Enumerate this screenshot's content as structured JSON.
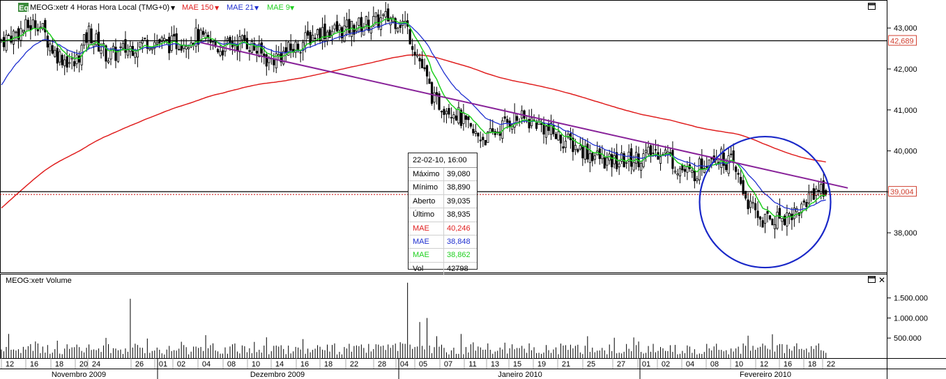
{
  "header": {
    "badge": "Eq",
    "symbol_line": "MEOG:xetr 4 Horas Hora Local (TMG+0)",
    "legend": [
      {
        "label": "MAE 150",
        "color": "#e02020"
      },
      {
        "label": "MAE 21",
        "color": "#2030d0"
      },
      {
        "label": "MAE 9",
        "color": "#20d020"
      }
    ]
  },
  "volume_panel": {
    "title": "MEOG:xetr Volume"
  },
  "tooltip": {
    "date": "22-02-10, 16:00",
    "rows": [
      {
        "label": "Máximo",
        "value": "39,080",
        "color": "#000000"
      },
      {
        "label": "Mínimo",
        "value": "38,890",
        "color": "#000000"
      },
      {
        "label": "Aberto",
        "value": "39,035",
        "color": "#000000"
      },
      {
        "label": "Último",
        "value": "38,935",
        "color": "#000000"
      },
      {
        "label": "MAE",
        "value": "40,246",
        "color": "#e02020"
      },
      {
        "label": "MAE",
        "value": "38,848",
        "color": "#2030d0"
      },
      {
        "label": "MAE",
        "value": "38,862",
        "color": "#20d020"
      },
      {
        "label": "Vol",
        "value": "42798",
        "color": "#000000"
      }
    ]
  },
  "chart_data": {
    "type": "candlestick",
    "price_axis": {
      "ylim": [
        37.05,
        43.65
      ],
      "ticks": [
        43.0,
        42.0,
        41.0,
        40.0,
        39.0,
        38.0
      ],
      "tick_labels": [
        "43,000",
        "42,000",
        "41,000",
        "40,000",
        "39,000",
        "38,000"
      ],
      "level_labels": [
        {
          "value": 42.689,
          "label": "42,689",
          "color": "#d04030"
        },
        {
          "value": 39.004,
          "label": "39,004",
          "color": "#d04030"
        }
      ]
    },
    "volume_axis": {
      "ylim": [
        0,
        2050000
      ],
      "ticks": [
        1500000,
        1000000,
        500000
      ],
      "tick_labels": [
        "1.500.000",
        "1.000.000",
        "500.000"
      ]
    },
    "x_axis": {
      "day_labels": [
        "12",
        "16",
        "18",
        "20",
        "24",
        "26",
        "01",
        "02",
        "04",
        "08",
        "10",
        "14",
        "16",
        "18",
        "22",
        "28",
        "04",
        "05",
        "07",
        "11",
        "13",
        "15",
        "19",
        "21",
        "25",
        "27",
        "01",
        "02",
        "04",
        "08",
        "10",
        "12",
        "16",
        "18",
        "22"
      ],
      "month_labels": [
        "Novembro 2009",
        "Dezembro 2009",
        "Janeiro 2010",
        "Fevereiro 2010"
      ]
    },
    "horizontal_lines": [
      {
        "y": 42.689,
        "color": "#000000",
        "style": "solid"
      },
      {
        "y": 39.004,
        "color": "#000000",
        "style": "solid"
      },
      {
        "y": 38.935,
        "color": "#cc0000",
        "style": "dotted"
      }
    ],
    "trendline": {
      "from": [
        0,
        43.33
      ],
      "to": [
        360,
        39.0
      ],
      "color": "#882299"
    },
    "circle_annotation": {
      "center_index": 314,
      "center_price": 38.75,
      "color": "#1a28c8"
    },
    "series": [
      {
        "name": "MAE 150",
        "color": "#e02020"
      },
      {
        "name": "MAE 21",
        "color": "#2030d0"
      },
      {
        "name": "MAE 9",
        "color": "#20d020"
      }
    ],
    "summary": {
      "periods": 340,
      "first_close": 42.7,
      "peak_high": 43.62,
      "last_close": 38.935,
      "low": 37.95,
      "last_high": 39.08,
      "last_low": 38.89,
      "last_open": 39.035
    }
  }
}
